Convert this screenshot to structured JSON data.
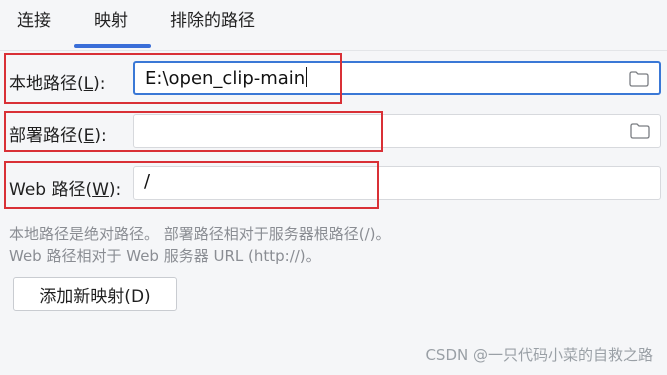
{
  "tabs": [
    {
      "label": "连接"
    },
    {
      "label": "映射"
    },
    {
      "label": "排除的路径"
    }
  ],
  "active_tab": "映射",
  "local_path": {
    "label_prefix": "本地路径(",
    "label_key": "L",
    "label_suffix": "):",
    "value": "E:\\open_clip-main"
  },
  "deploy_path": {
    "label_prefix": "部署路径(",
    "label_key": "E",
    "label_suffix": "):",
    "value": ""
  },
  "web_path": {
    "label_prefix": "Web 路径(",
    "label_key": "W",
    "label_suffix": "):",
    "value": "/"
  },
  "help": {
    "line1": "本地路径是绝对路径。 部署路径相对于服务器根路径(/)。",
    "line2": "Web 路径相对于 Web 服务器 URL (http://)。"
  },
  "add_button_label": "添加新映射(D)",
  "watermark": "CSDN @一只代码小菜的自救之路",
  "colors": {
    "accent": "#3a78d6",
    "highlight": "#d93036"
  }
}
